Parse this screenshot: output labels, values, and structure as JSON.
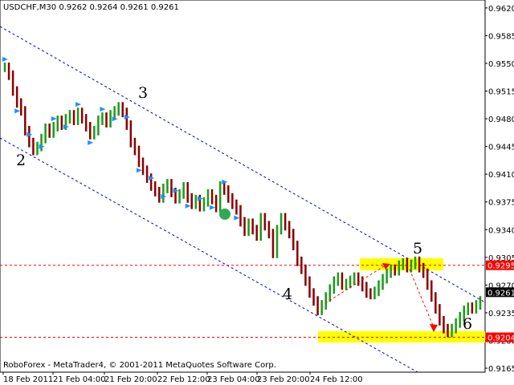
{
  "chart_data": {
    "type": "line",
    "symbol_info": "USDCHF,M30  0.9262 0.9264 0.9261 0.9261",
    "footer": "RoboForex - MetaTrader4, © 2001-2011 MetaQuotes Software Corp.",
    "y_ticks": [
      "0.9620",
      "0.9585",
      "0.9550",
      "0.9515",
      "0.9480",
      "0.9445",
      "0.9410",
      "0.9375",
      "0.9340",
      "0.9305",
      "0.9270",
      "0.9235",
      "0.9200",
      "0.9165"
    ],
    "x_ticks": [
      "18 Feb 2011",
      "21 Feb 04:00",
      "21 Feb 20:00",
      "22 Feb 12:00",
      "23 Feb 04:00",
      "23 Feb 20:00",
      "24 Feb 12:00"
    ],
    "ylim": [
      0.916,
      0.963
    ],
    "levels": [
      {
        "value": 0.9295,
        "label": "0.9295",
        "color": "#ff0000"
      },
      {
        "value": 0.9204,
        "label": "0.9204",
        "color": "#ff0000"
      }
    ],
    "current_price": {
      "value": 0.9261,
      "label": "0.9261"
    },
    "wave_labels": [
      "2",
      "3",
      "4",
      "5",
      "6"
    ],
    "colors": {
      "price": "#1a9c1a",
      "bear": "#8b0000",
      "channel": "#0000cc",
      "zone": "#ffff00",
      "arrow": "#ff0000",
      "fractal": "#1e90ff"
    },
    "price_series": [
      0.9545,
      0.9535,
      0.9515,
      0.95,
      0.949,
      0.9465,
      0.945,
      0.944,
      0.9445,
      0.9455,
      0.9468,
      0.9462,
      0.947,
      0.9478,
      0.9472,
      0.948,
      0.9485,
      0.9478,
      0.9488,
      0.948,
      0.947,
      0.946,
      0.9465,
      0.9478,
      0.9482,
      0.9475,
      0.9485,
      0.949,
      0.9495,
      0.9488,
      0.9472,
      0.945,
      0.944,
      0.9425,
      0.9415,
      0.9405,
      0.9395,
      0.9388,
      0.938,
      0.9392,
      0.9398,
      0.9387,
      0.9379,
      0.9385,
      0.9394,
      0.938,
      0.9372,
      0.9378,
      0.9369,
      0.9375,
      0.9385,
      0.9378,
      0.9368,
      0.9395,
      0.939,
      0.938,
      0.9372,
      0.9365,
      0.935,
      0.9338,
      0.9348,
      0.934,
      0.9332,
      0.9355,
      0.9345,
      0.9335,
      0.931,
      0.934,
      0.9355,
      0.9345,
      0.9335,
      0.932,
      0.93,
      0.929,
      0.9275,
      0.926,
      0.925,
      0.9238,
      0.9245,
      0.9255,
      0.9265,
      0.9275,
      0.928,
      0.927,
      0.9272,
      0.9276,
      0.928,
      0.9275,
      0.9268,
      0.926,
      0.9258,
      0.9262,
      0.927,
      0.9278,
      0.9285,
      0.929,
      0.9288,
      0.9295,
      0.9298,
      0.9292,
      0.9296,
      0.93,
      0.9292,
      0.9285,
      0.927,
      0.9255,
      0.924,
      0.9225,
      0.9215,
      0.921,
      0.9215,
      0.9222,
      0.923,
      0.9238,
      0.9242,
      0.924,
      0.9245,
      0.925
    ]
  }
}
